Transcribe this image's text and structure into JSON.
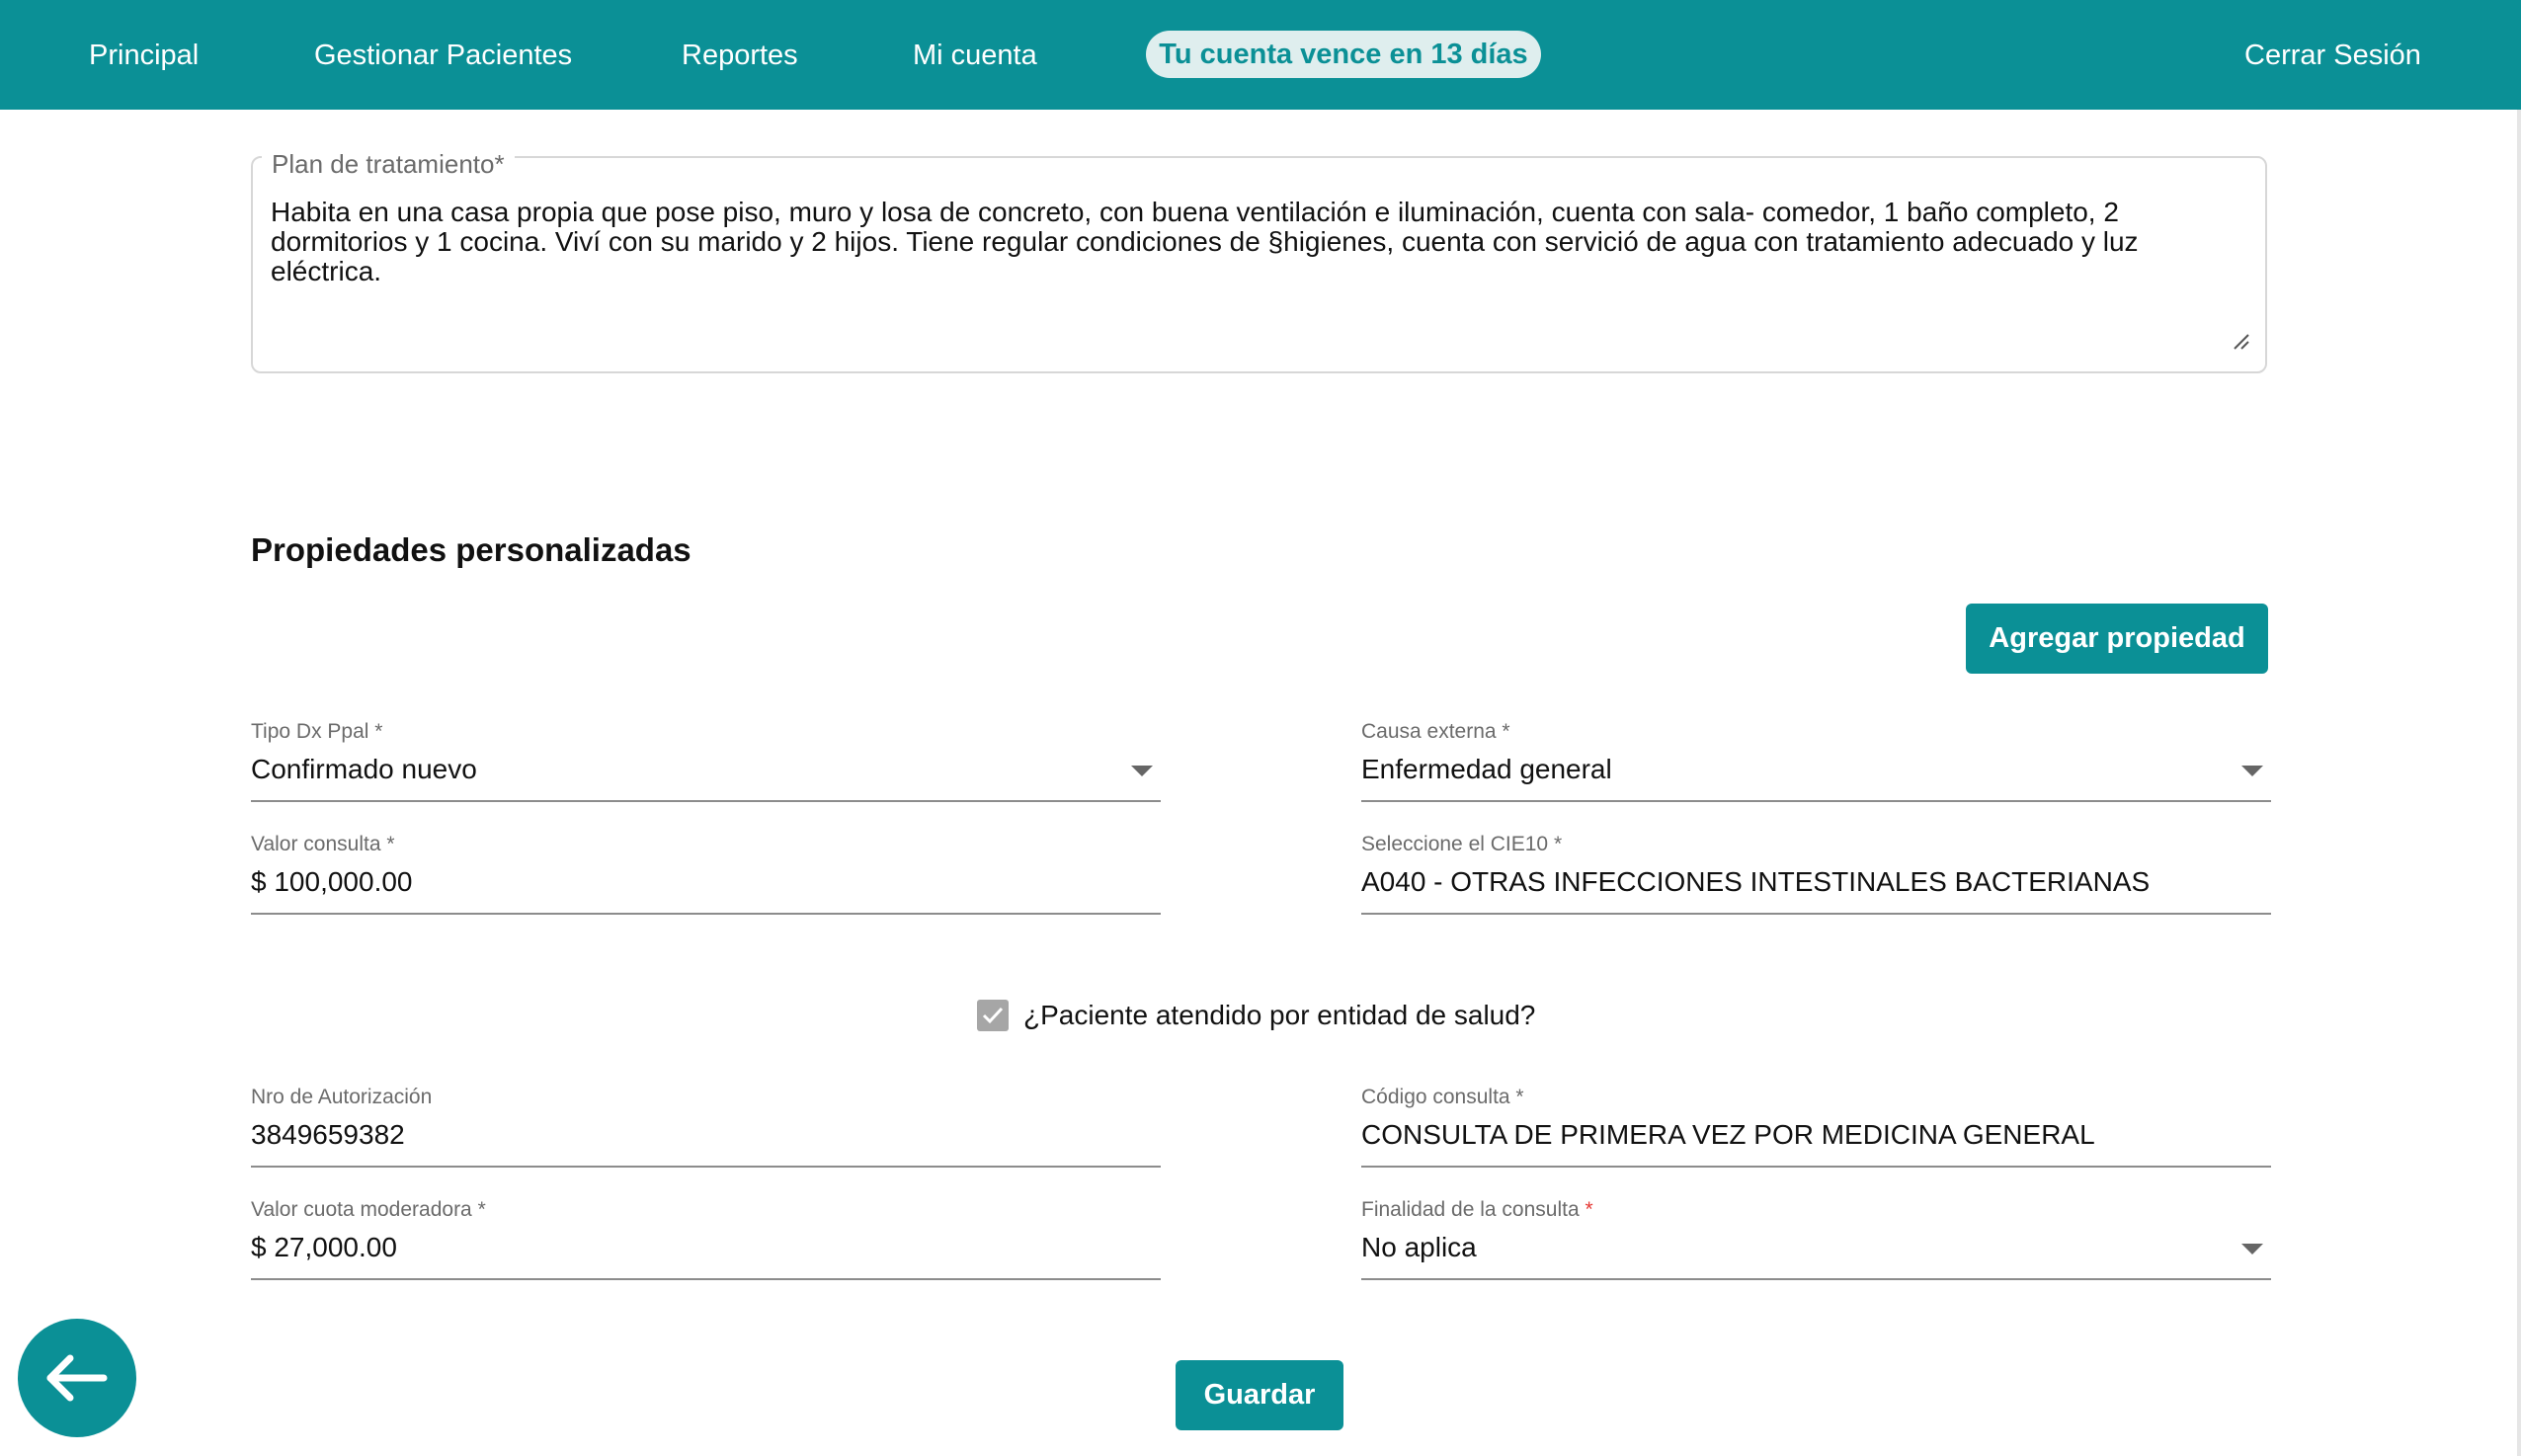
{
  "nav": {
    "items": [
      "Principal",
      "Gestionar Pacientes",
      "Reportes",
      "Mi cuenta"
    ],
    "expiry_pill": "Tu cuenta vence en 13 días",
    "logout": "Cerrar Sesión"
  },
  "plan": {
    "legend": "Plan de tratamiento*",
    "text": "Habita en una casa propia que pose piso, muro y losa de concreto, con buena ventilación e iluminación, cuenta con sala- comedor, 1 baño completo, 2 dormitorios y 1 cocina. Viví con su marido y 2 hijos. Tiene regular condiciones de §higienes, cuenta con servició de agua con tratamiento adecuado y luz eléctrica."
  },
  "custom": {
    "title": "Propiedades personalizadas",
    "add_button": "Agregar propiedad"
  },
  "fields": {
    "tipo_dx": {
      "label": "Tipo Dx Ppal *",
      "value": "Confirmado nuevo"
    },
    "causa_externa": {
      "label": "Causa externa *",
      "value": "Enfermedad general"
    },
    "valor_consulta": {
      "label": "Valor consulta *",
      "value": "$ 100,000.00"
    },
    "cie10": {
      "label": "Seleccione el CIE10 *",
      "value": "A040 - OTRAS INFECCIONES INTESTINALES BACTERIANAS"
    },
    "nro_autorizacion": {
      "label": "Nro de Autorización",
      "value": "3849659382"
    },
    "codigo_consulta": {
      "label": "Código consulta *",
      "value": "CONSULTA DE PRIMERA VEZ POR MEDICINA GENERAL"
    },
    "cuota_moderadora": {
      "label": "Valor cuota moderadora *",
      "value": "$ 27,000.00"
    },
    "finalidad": {
      "label": "Finalidad de la consulta",
      "required_mark": "*",
      "value": "No aplica"
    }
  },
  "checkbox": {
    "label": "¿Paciente atendido por entidad de salud?",
    "checked": true
  },
  "save_button": "Guardar",
  "back_button_icon": "arrow-left-icon",
  "colors": {
    "primary": "#0b9096",
    "pill_bg": "#dfeeee"
  }
}
